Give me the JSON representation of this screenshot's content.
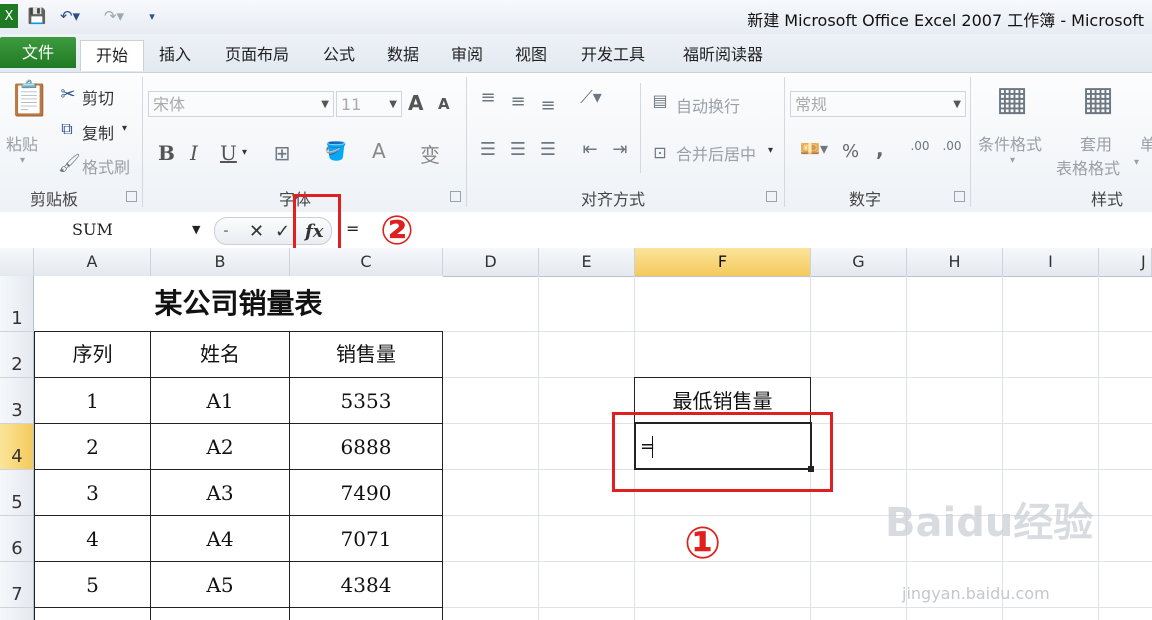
{
  "window": {
    "title": "新建 Microsoft Office Excel 2007 工作簿 - Microsoft"
  },
  "tabs": {
    "file": "文件",
    "items": [
      "开始",
      "插入",
      "页面布局",
      "公式",
      "数据",
      "审阅",
      "视图",
      "开发工具",
      "福昕阅读器"
    ]
  },
  "ribbon": {
    "clipboard": {
      "paste": "粘贴",
      "cut": "剪切",
      "copy": "复制",
      "format_painter": "格式刷",
      "label": "剪贴板"
    },
    "font": {
      "name": "宋体",
      "size": "11",
      "bold": "B",
      "italic": "I",
      "underline": "U",
      "grow": "A",
      "shrink": "A",
      "color_a": "A",
      "phonetic": "变",
      "label": "字体"
    },
    "alignment": {
      "wrap": "自动换行",
      "merge": "合并后居中",
      "label": "对齐方式"
    },
    "number": {
      "format": "常规",
      "percent": "%",
      "comma": ",",
      "label": "数字"
    },
    "styles": {
      "conditional": "条件格式",
      "table_line1": "套用",
      "table_line2": "表格格式",
      "cell_partial": "单",
      "label": "样式"
    }
  },
  "formula_bar": {
    "name_box": "SUM",
    "cancel": "✕",
    "enter": "✓",
    "fx": "fx",
    "content": "="
  },
  "annotations": {
    "one": "①",
    "two": "②"
  },
  "grid": {
    "columns": [
      "A",
      "B",
      "C",
      "D",
      "E",
      "F",
      "G",
      "H",
      "I",
      "J"
    ],
    "rows": [
      "1",
      "2",
      "3",
      "4",
      "5",
      "6",
      "7"
    ],
    "selected_column": "F",
    "selected_row": "4"
  },
  "sheet": {
    "title": "某公司销量表",
    "headers": [
      "序列",
      "姓名",
      "销售量"
    ],
    "rows": [
      [
        "1",
        "A1",
        "5353"
      ],
      [
        "2",
        "A2",
        "6888"
      ],
      [
        "3",
        "A3",
        "7490"
      ],
      [
        "4",
        "A4",
        "7071"
      ],
      [
        "5",
        "A5",
        "4384"
      ]
    ],
    "f3_label": "最低销售量",
    "f4_value": "="
  },
  "watermark": {
    "brand": "Baidu经验",
    "url": "jingyan.baidu.com"
  }
}
